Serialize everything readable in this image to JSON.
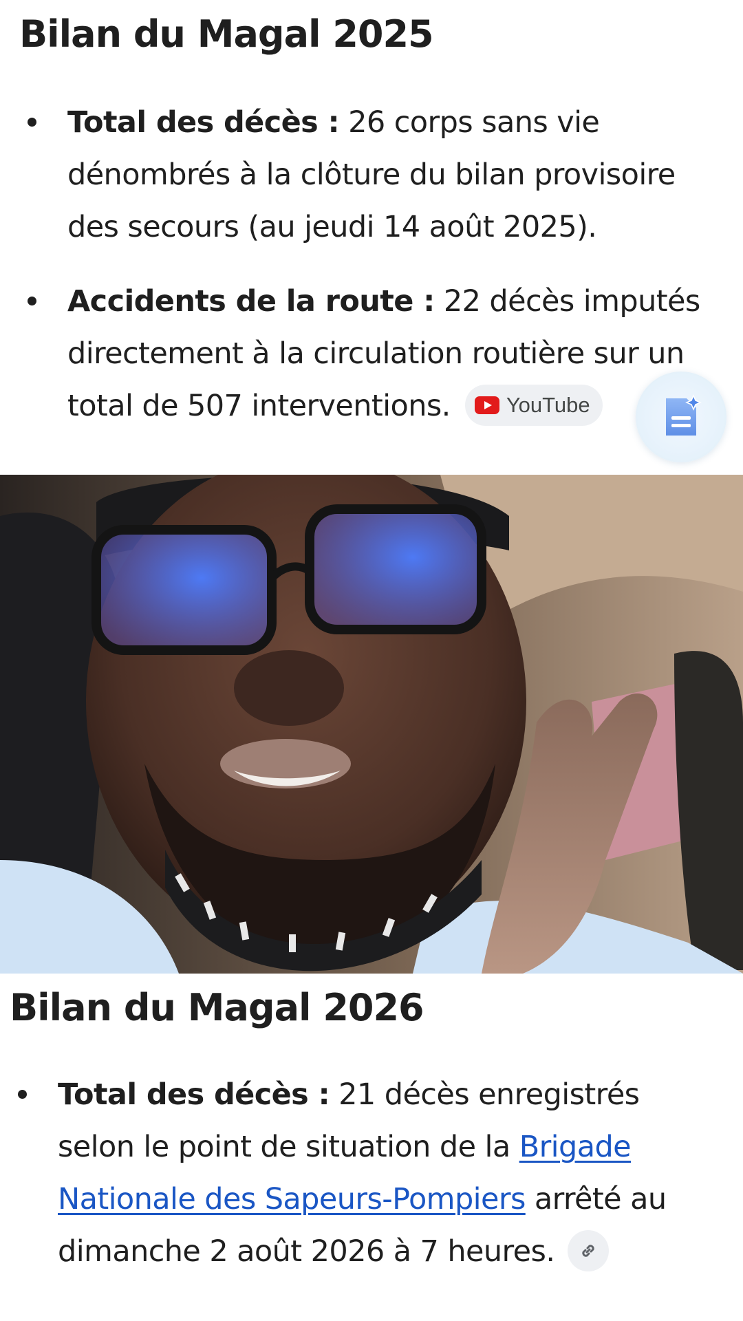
{
  "section_2025": {
    "heading": "Bilan du Magal 2025",
    "items": [
      {
        "label": "Total des décès :",
        "text": " 26 corps sans vie dénombrés à la clôture du bilan provisoire des secours (au jeudi 14 août 2025)."
      },
      {
        "label": "Accidents de la route :",
        "text": " 22 décès imputés directement à la circulation routière sur un total de 507 interventions.",
        "source_chip": {
          "label": "YouTube",
          "icon": "youtube-icon"
        }
      }
    ]
  },
  "fab": {
    "icon": "doc-sparkle-icon"
  },
  "video": {
    "description_icon": "video-frame"
  },
  "section_2026": {
    "heading": "Bilan du Magal 2026",
    "items": [
      {
        "label": "Total des décès :",
        "text_before": " 21 décès enregistrés selon le point de situation de la ",
        "link_text": "Brigade Nationale des Sapeurs-Pompiers",
        "text_after": " arrêté au dimanche 2 août 2026 à 7 heures.",
        "link_chip_icon": "link-icon"
      }
    ]
  },
  "colors": {
    "text": "#1f1f1f",
    "link": "#1a56c4",
    "chip_bg": "#eef0f3",
    "youtube_red": "#e21b1b"
  }
}
